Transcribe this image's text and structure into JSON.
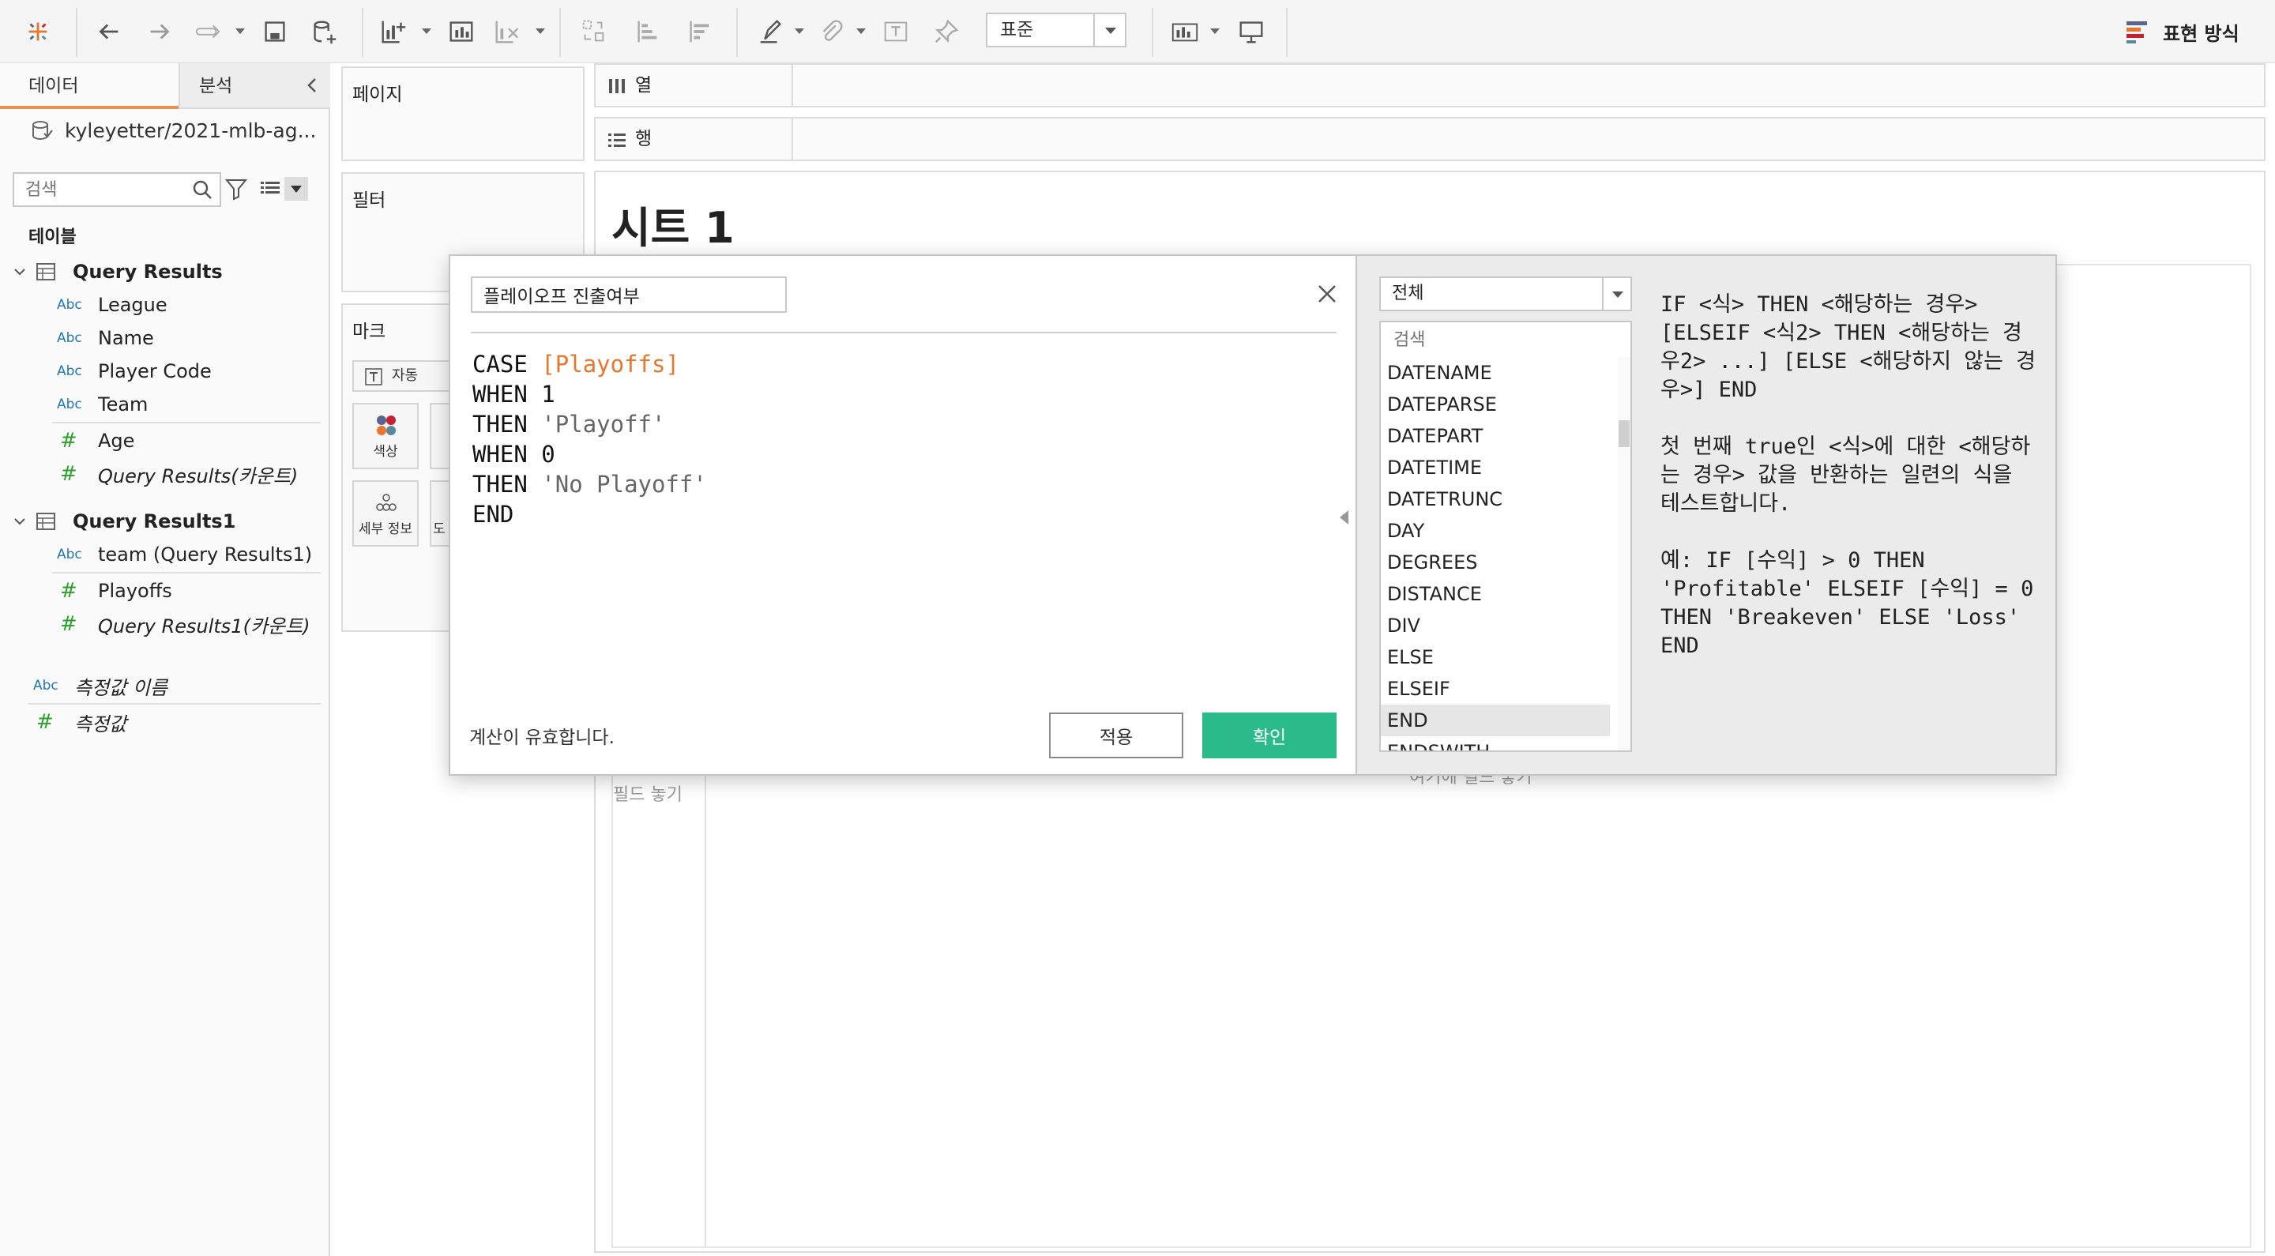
{
  "toolbar": {
    "fit_label": "표준",
    "show_me_label": "표현 방식"
  },
  "data_pane": {
    "tab_data": "데이터",
    "tab_analysis": "분석",
    "datasource": "kyleyetter/2021-mlb-ag...",
    "search_placeholder": "검색",
    "tables_heading": "테이블",
    "tables": [
      {
        "name": "Query Results",
        "fields": [
          {
            "type": "Abc",
            "name": "League"
          },
          {
            "type": "Abc",
            "name": "Name"
          },
          {
            "type": "Abc",
            "name": "Player Code"
          },
          {
            "type": "Abc",
            "name": "Team"
          },
          {
            "type": "#",
            "name": "Age"
          },
          {
            "type": "#",
            "name": "Query Results(카운트)"
          }
        ]
      },
      {
        "name": "Query Results1",
        "fields": [
          {
            "type": "Abc",
            "name": "team (Query Results1)"
          },
          {
            "type": "#",
            "name": "Playoffs"
          },
          {
            "type": "#",
            "name": "Query Results1(카운트)"
          }
        ]
      }
    ],
    "measure_names": {
      "type": "Abc",
      "name": "측정값 이름"
    },
    "measure_values": {
      "type": "#",
      "name": "측정값"
    }
  },
  "cards": {
    "pages": "페이지",
    "filters": "필터",
    "marks": "마크",
    "marks_type": "자동",
    "color_btn": "색상",
    "detail_btn": "세부 정보",
    "partial_btn": "도"
  },
  "shelves": {
    "columns": "열",
    "rows": "행"
  },
  "sheet": {
    "title": "시트 1",
    "drop_left": "필드 놓기",
    "drop_center": "여기에 필드 놓기"
  },
  "calc_dialog": {
    "name": "플레이오프 진출여부",
    "code": {
      "l1_kw": "CASE",
      "l1_field": "[Playoffs]",
      "l2": "WHEN 1",
      "l3_kw": "THEN",
      "l3_str": "'Playoff'",
      "l4": "WHEN 0",
      "l5_kw": "THEN",
      "l5_str": "'No Playoff'",
      "l6": "END"
    },
    "status": "계산이 유효합니다.",
    "apply": "적용",
    "ok": "확인",
    "function_category": "전체",
    "function_search_placeholder": "검색",
    "functions": [
      "DATENAME",
      "DATEPARSE",
      "DATEPART",
      "DATETIME",
      "DATETRUNC",
      "DAY",
      "DEGREES",
      "DISTANCE",
      "DIV",
      "ELSE",
      "ELSEIF",
      "END",
      "ENDSWITH"
    ],
    "selected_function": "END",
    "help_syntax": "IF <식> THEN <해당하는 경우> [ELSEIF <식2> THEN <해당하는 경우2> ...] [ELSE <해당하지 않는 경우>] END",
    "help_description": "첫 번째 true인 <식>에 대한 <해당하는 경우> 값을 반환하는 일련의 식을 테스트합니다.",
    "help_example": "예: IF [수익] > 0 THEN 'Profitable' ELSEIF [수익] = 0 THEN 'Breakeven' ELSE 'Loss' END"
  },
  "colors": {
    "accent_orange": "#e8762c",
    "ok_green": "#2bbb8a",
    "dimension_blue": "#1f77b4",
    "measure_green": "#2ca02c"
  }
}
